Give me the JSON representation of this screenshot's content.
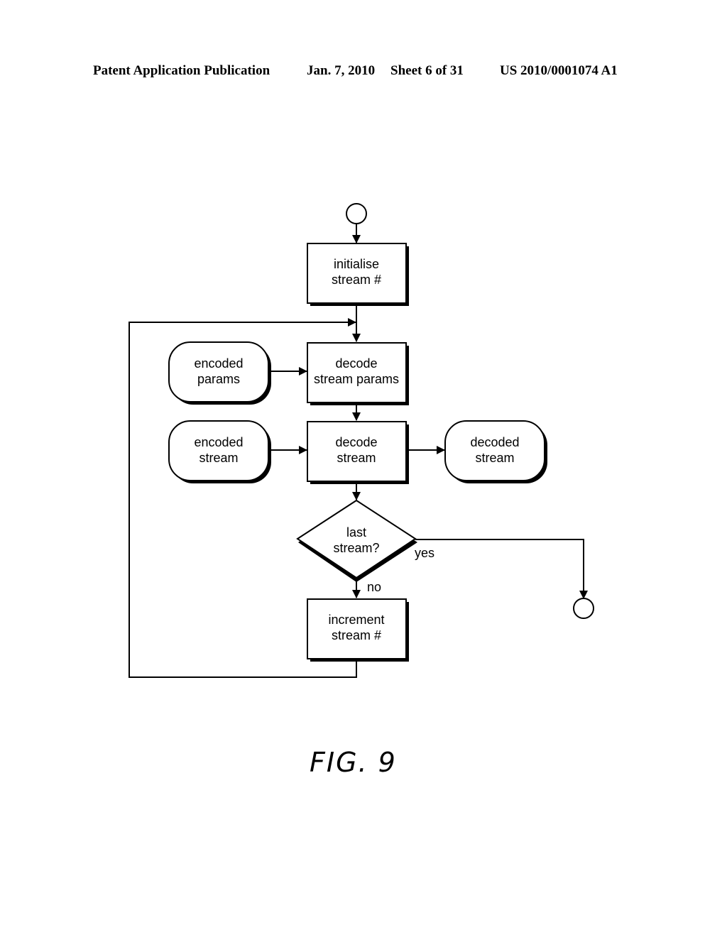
{
  "header": {
    "publication": "Patent Application Publication",
    "date": "Jan. 7, 2010",
    "sheet": "Sheet 6 of 31",
    "number": "US 2010/0001074 A1"
  },
  "figure": {
    "caption": "FIG. 9",
    "nodes": {
      "start": {
        "type": "terminal"
      },
      "initialise": {
        "type": "process",
        "lines": [
          "initialise",
          "stream #"
        ]
      },
      "encoded_params": {
        "type": "data",
        "lines": [
          "encoded",
          "params"
        ]
      },
      "decode_params": {
        "type": "process",
        "lines": [
          "decode",
          "stream params"
        ]
      },
      "encoded_stream": {
        "type": "data",
        "lines": [
          "encoded",
          "stream"
        ]
      },
      "decode_stream": {
        "type": "process",
        "lines": [
          "decode",
          "stream"
        ]
      },
      "decoded_stream": {
        "type": "data",
        "lines": [
          "decoded",
          "stream"
        ]
      },
      "last_stream": {
        "type": "decision",
        "lines": [
          "last",
          "stream?"
        ]
      },
      "increment": {
        "type": "process",
        "lines": [
          "increment",
          "stream #"
        ]
      },
      "end": {
        "type": "terminal"
      }
    },
    "edge_labels": {
      "yes": "yes",
      "no": "no"
    },
    "edges": [
      [
        "start",
        "initialise"
      ],
      [
        "initialise",
        "decode_params"
      ],
      [
        "encoded_params",
        "decode_params"
      ],
      [
        "decode_params",
        "decode_stream"
      ],
      [
        "encoded_stream",
        "decode_stream"
      ],
      [
        "decode_stream",
        "decoded_stream"
      ],
      [
        "decode_stream",
        "last_stream"
      ],
      [
        "last_stream",
        "end",
        "yes"
      ],
      [
        "last_stream",
        "increment",
        "no"
      ],
      [
        "increment",
        "decode_params"
      ]
    ]
  }
}
